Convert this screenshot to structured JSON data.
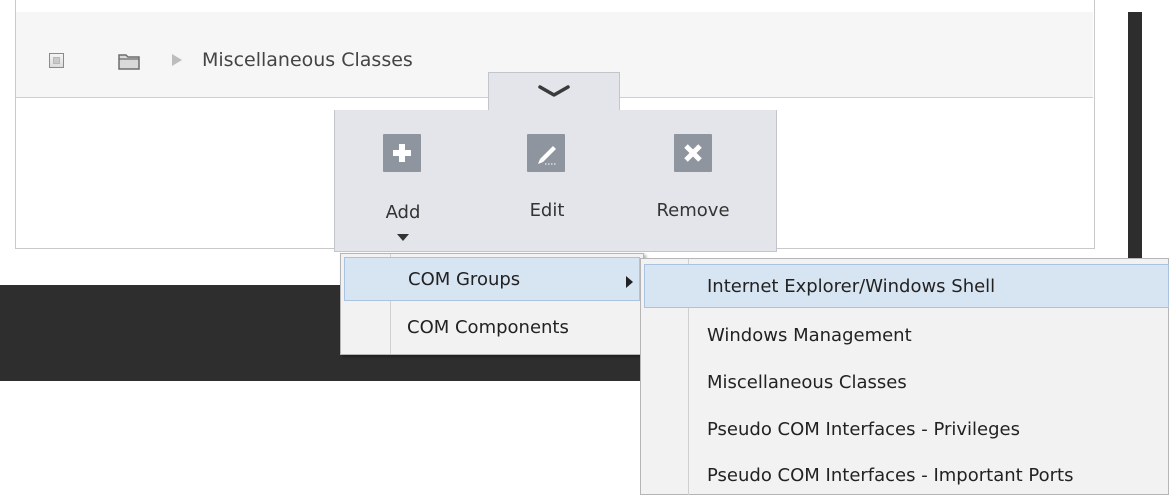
{
  "row": {
    "label": "Miscellaneous Classes"
  },
  "toolbar": {
    "add_label": "Add",
    "edit_label": "Edit",
    "remove_label": "Remove"
  },
  "context_menu": {
    "items": [
      {
        "label": "COM Groups",
        "highlighted": true,
        "has_submenu": true
      },
      {
        "label": "COM Components",
        "highlighted": false
      }
    ]
  },
  "submenu": {
    "items": [
      {
        "label": "Internet Explorer/Windows Shell",
        "highlighted": true
      },
      {
        "label": "Windows Management"
      },
      {
        "label": "Miscellaneous Classes"
      },
      {
        "label": "Pseudo COM Interfaces - Privileges"
      },
      {
        "label": "Pseudo COM Interfaces - Important Ports"
      }
    ]
  },
  "colors": {
    "highlight": "#d7e4f2",
    "toolbar_bg": "#e3e5ea",
    "icon_bg": "#8f959e",
    "dark_band": "#2e2e2e"
  },
  "icons": [
    "checkbox-icon",
    "folder-icon",
    "expand-arrow-icon",
    "chevron-down-icon",
    "plus-icon",
    "pencil-icon",
    "close-icon",
    "caret-down-icon",
    "submenu-arrow-icon"
  ]
}
